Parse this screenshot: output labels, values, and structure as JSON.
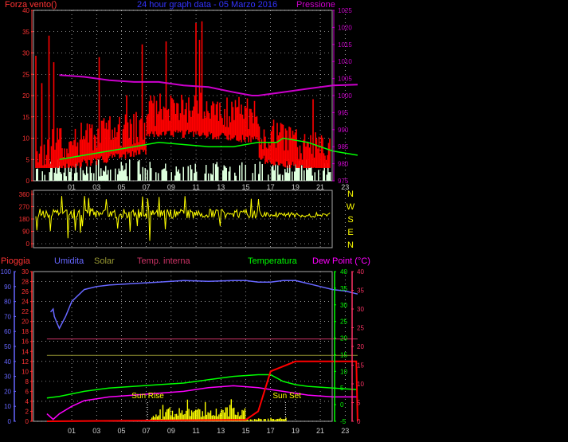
{
  "header": {
    "left_label": "Forza vento()",
    "title": "24 hour graph data - 05 Marzo 2016",
    "right_label": "Pressione"
  },
  "colors": {
    "wind": "#ff0000",
    "gust": "#00ff00",
    "pressure": "#cc00cc",
    "direction": "#ffff00",
    "humidity": "#6666ff",
    "solar": "#999933",
    "temp_in": "#cc3366",
    "temp_out": "#00ff00",
    "dew": "#ff00ff",
    "rain": "#ff0000",
    "sun": "#ffff00",
    "grid": "#ffffff",
    "axis_left": "#ff3333",
    "axis_pressure": "#cc00cc",
    "axis_humidity": "#6666ff",
    "axis_temp": "#00ff00",
    "axis_dew": "#ff3366",
    "compass": "#ffff00"
  },
  "chart_data": [
    {
      "type": "line",
      "name": "wind-pressure",
      "x_ticks": [
        "01",
        "03",
        "05",
        "07",
        "09",
        "11",
        "13",
        "15",
        "17",
        "19",
        "21",
        "23"
      ],
      "ylim_left": [
        0,
        40
      ],
      "yticks_left": [
        0,
        5,
        10,
        15,
        20,
        25,
        30,
        35,
        40
      ],
      "ylim_right": [
        975,
        1025
      ],
      "yticks_right": [
        975,
        980,
        985,
        990,
        995,
        1000,
        1005,
        1010,
        1015,
        1020,
        1025
      ],
      "grid": true,
      "pressure_x": [
        0,
        2,
        4,
        6,
        8,
        10,
        12,
        14,
        15.5,
        16,
        18,
        20,
        22,
        24
      ],
      "pressure_y": [
        1006,
        1005.5,
        1004.5,
        1004,
        1004,
        1003,
        1002.5,
        1001,
        1000,
        1000,
        1001,
        1002,
        1003,
        1003.2
      ],
      "gust_x": [
        0,
        2,
        4,
        6,
        8,
        10,
        12,
        14,
        16,
        17.5,
        18,
        20,
        22,
        24
      ],
      "gust_y": [
        5,
        6,
        7,
        8,
        9,
        8.5,
        8,
        8,
        9,
        9,
        10,
        9,
        7,
        6
      ]
    },
    {
      "type": "line",
      "name": "wind-direction",
      "ylim": [
        0,
        360
      ],
      "yticks": [
        0,
        90,
        180,
        270,
        360
      ],
      "compass": [
        "N",
        "W",
        "S",
        "E",
        "N"
      ],
      "baseline": 220
    },
    {
      "type": "line",
      "name": "climate",
      "x_ticks": [
        "01",
        "03",
        "05",
        "07",
        "09",
        "11",
        "13",
        "15",
        "17",
        "19",
        "21",
        "23"
      ],
      "legend": [
        "Pioggia",
        "Umidita",
        "Solar",
        "Temp. interna",
        "Temperatura",
        "Dew Point (°C)"
      ],
      "ylim_humidity": [
        0,
        100
      ],
      "yticks_humidity": [
        0,
        10,
        20,
        30,
        40,
        50,
        60,
        70,
        80,
        90,
        100
      ],
      "ylim_rain": [
        0,
        30
      ],
      "yticks_rain": [
        0,
        2,
        4,
        6,
        8,
        10,
        12,
        14,
        16,
        18,
        20,
        22,
        24,
        26,
        28,
        30
      ],
      "ylim_temp": [
        -5,
        40
      ],
      "yticks_temp": [
        -5,
        0,
        5,
        10,
        15,
        20,
        25,
        30,
        35,
        40
      ],
      "ylim_dew": [
        0,
        40
      ],
      "yticks_dew": [
        0,
        5,
        10,
        15,
        20,
        25,
        30,
        35,
        40
      ],
      "annotations": [
        "Sun Rise",
        "Sun Set"
      ],
      "sunrise_x": 7.1,
      "sunset_x": 18.2,
      "humidity_x": [
        -0.7,
        -0.5,
        -0.4,
        -0.2,
        0,
        0.5,
        1,
        2,
        3,
        4,
        6,
        8,
        10,
        12,
        14,
        15,
        16,
        17,
        18,
        19,
        20,
        21,
        22,
        23,
        24
      ],
      "humidity_y": [
        73,
        75,
        70,
        66,
        62,
        70,
        80,
        88,
        90,
        91,
        92,
        93,
        94,
        93.5,
        94,
        94,
        93,
        93,
        94,
        94,
        92,
        90,
        88,
        87,
        85
      ],
      "solar_x": [
        -1,
        24
      ],
      "solar_y": [
        44,
        44
      ],
      "temp_in_x": [
        -1,
        24
      ],
      "temp_in_y": [
        55,
        55
      ],
      "temp_out_x": [
        -1,
        0,
        2,
        4,
        6,
        8,
        10,
        12,
        14,
        16,
        17,
        18,
        19,
        20,
        22,
        24
      ],
      "temp_out_y": [
        2,
        2.5,
        4,
        5,
        5.5,
        6,
        6.5,
        7.5,
        8.5,
        9,
        9,
        7,
        6,
        5.5,
        5,
        4.5
      ],
      "dew_x": [
        -1,
        -0.5,
        0,
        1,
        2,
        4,
        6,
        8,
        10,
        12,
        14,
        16,
        17,
        18,
        19,
        20,
        22,
        24
      ],
      "dew_y": [
        2,
        0.5,
        2,
        4,
        5.5,
        6.5,
        7,
        7.5,
        8,
        9,
        9.5,
        9,
        8.5,
        8,
        7.5,
        7,
        6.5,
        6.5
      ],
      "rain_x": [
        -1,
        15,
        16,
        17,
        18,
        19,
        20,
        21,
        22,
        23,
        23.9,
        24
      ],
      "rain_y": [
        0,
        0.3,
        2,
        10,
        11,
        12,
        12,
        12,
        12,
        12,
        12,
        0
      ]
    }
  ]
}
